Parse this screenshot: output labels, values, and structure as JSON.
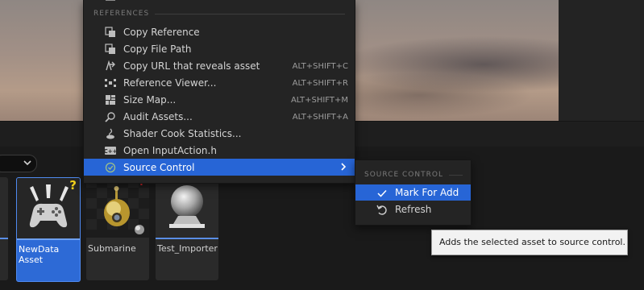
{
  "context_menu": {
    "section_title": "REFERENCES",
    "items": [
      {
        "label": "Copy Reference",
        "shortcut": "",
        "icon": "copy-reference-icon"
      },
      {
        "label": "Copy File Path",
        "shortcut": "",
        "icon": "copy-path-icon"
      },
      {
        "label": "Copy URL that reveals asset",
        "shortcut": "ALT+SHIFT+C",
        "icon": "copy-url-icon"
      },
      {
        "label": "Reference Viewer...",
        "shortcut": "ALT+SHIFT+R",
        "icon": "reference-viewer-icon"
      },
      {
        "label": "Size Map...",
        "shortcut": "ALT+SHIFT+M",
        "icon": "size-map-icon"
      },
      {
        "label": "Audit Assets...",
        "shortcut": "ALT+SHIFT+A",
        "icon": "audit-icon"
      },
      {
        "label": "Shader Cook Statistics...",
        "shortcut": "",
        "icon": "shader-icon"
      },
      {
        "label": "Open InputAction.h",
        "shortcut": "",
        "icon": "cpp-file-icon"
      },
      {
        "label": "Source Control",
        "shortcut": "",
        "icon": "source-control-icon"
      }
    ]
  },
  "submenu": {
    "section_title": "SOURCE CONTROL",
    "items": [
      {
        "label": "Mark For Add",
        "icon": "checkmark-icon"
      },
      {
        "label": "Refresh",
        "icon": "refresh-icon"
      }
    ]
  },
  "tooltip": {
    "text": "Adds the selected asset to source control."
  },
  "assets": [
    {
      "name": "NewData\nAsset",
      "selected": true
    },
    {
      "name": "Submarine",
      "selected": false
    },
    {
      "name": "Test_Importer",
      "selected": false
    }
  ],
  "colors": {
    "highlight": "#2765d6",
    "menu_bg": "#242424",
    "tile_bar": "#5a8ee6",
    "badge_question": "#f2d21c",
    "badge_plus": "#e0262a"
  }
}
